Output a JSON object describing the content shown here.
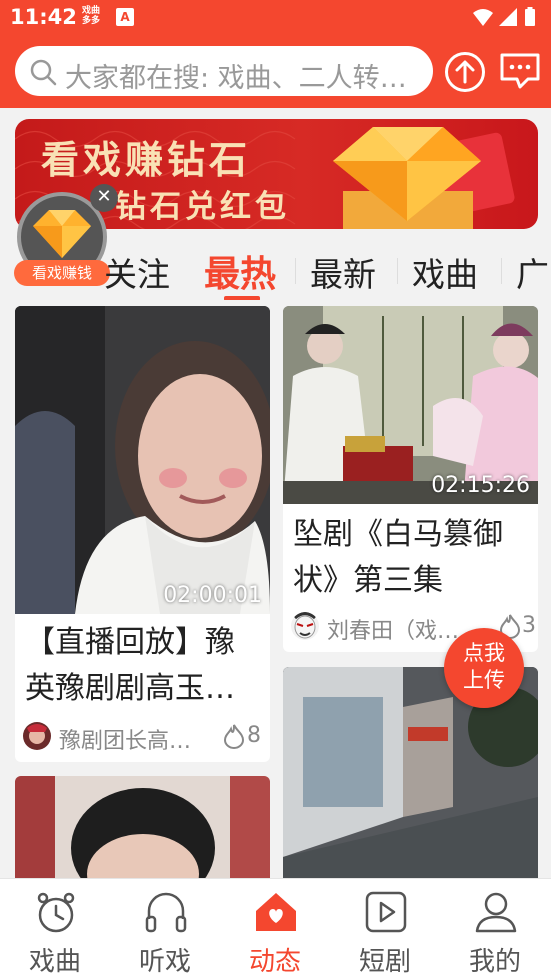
{
  "status_bar": {
    "time": "11:42",
    "app_badge": "戏曲\n多多",
    "a_icon": "A"
  },
  "search": {
    "placeholder": "大家都在搜: 戏曲、二人转、京剧"
  },
  "banner": {
    "line1": "看戏赚钻石",
    "line2": "钻石兑红包"
  },
  "earn_widget": {
    "label": "看戏赚钱"
  },
  "tabs": [
    {
      "label": "关注",
      "active": false
    },
    {
      "label": "最热",
      "active": true
    },
    {
      "label": "最新",
      "active": false
    },
    {
      "label": "戏曲",
      "active": false
    },
    {
      "label": "广",
      "active": false
    }
  ],
  "cards": [
    {
      "duration": "02:00:01",
      "title": "【直播回放】豫英豫剧剧高玉…",
      "author": "豫剧团长高…",
      "likes": "8"
    },
    {
      "duration": "02:15:26",
      "title": "坠剧《白马篡御状》第三集",
      "author": "刘春田（戏…",
      "likes": "3"
    }
  ],
  "upload_fab": {
    "label": "点我上传"
  },
  "bottom_nav": [
    {
      "label": "戏曲",
      "icon": "alarm-clock-icon",
      "active": false
    },
    {
      "label": "听戏",
      "icon": "headphones-icon",
      "active": false
    },
    {
      "label": "动态",
      "icon": "home-heart-icon",
      "active": true
    },
    {
      "label": "短剧",
      "icon": "play-square-icon",
      "active": false
    },
    {
      "label": "我的",
      "icon": "user-icon",
      "active": false
    }
  ],
  "colors": {
    "accent": "#f4472f",
    "banner_red": "#c41a1a",
    "gold_text": "#f9e1b5",
    "fab": "#f4472f"
  }
}
